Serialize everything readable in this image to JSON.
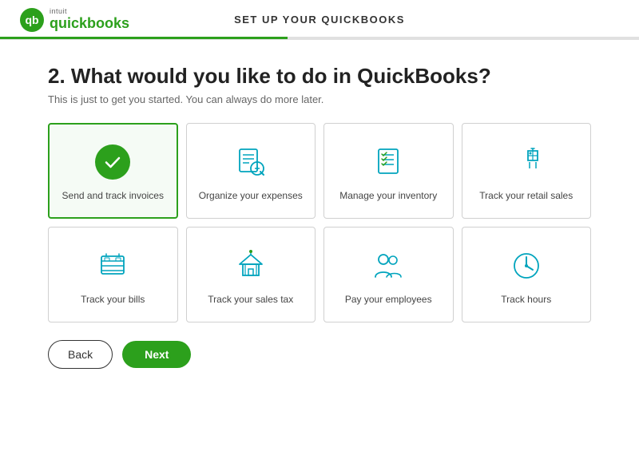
{
  "header": {
    "title": "SET UP YOUR QUICKBOOKS",
    "logo_brand": "quickbooks",
    "logo_intuit": "intuit",
    "progress_percent": 45
  },
  "page": {
    "step_number": "2.",
    "question": "What would you like to do in QuickBooks?",
    "subtitle": "This is just to get you started. You can always do more later."
  },
  "options": [
    {
      "id": "send-track-invoices",
      "label": "Send and track invoices",
      "selected": true,
      "icon": "invoice-icon"
    },
    {
      "id": "organize-expenses",
      "label": "Organize your expenses",
      "selected": false,
      "icon": "expenses-icon"
    },
    {
      "id": "manage-inventory",
      "label": "Manage your inventory",
      "selected": false,
      "icon": "inventory-icon"
    },
    {
      "id": "track-retail-sales",
      "label": "Track your retail sales",
      "selected": false,
      "icon": "retail-icon"
    },
    {
      "id": "track-bills",
      "label": "Track your bills",
      "selected": false,
      "icon": "bills-icon"
    },
    {
      "id": "track-sales-tax",
      "label": "Track your sales tax",
      "selected": false,
      "icon": "sales-tax-icon"
    },
    {
      "id": "pay-employees",
      "label": "Pay your employees",
      "selected": false,
      "icon": "employees-icon"
    },
    {
      "id": "track-hours",
      "label": "Track hours",
      "selected": false,
      "icon": "hours-icon"
    }
  ],
  "buttons": {
    "back_label": "Back",
    "next_label": "Next"
  }
}
